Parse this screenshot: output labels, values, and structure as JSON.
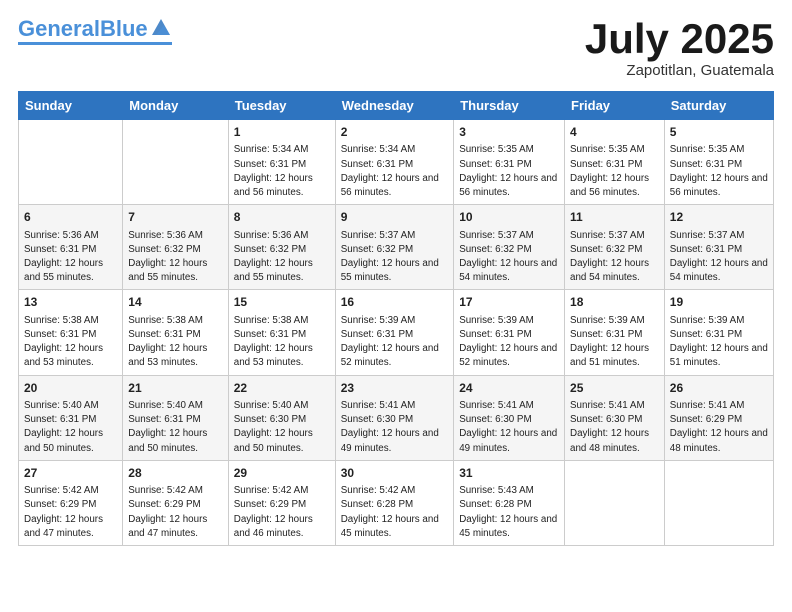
{
  "logo": {
    "part1": "General",
    "part2": "Blue"
  },
  "title": "July 2025",
  "location": "Zapotitlan, Guatemala",
  "days_of_week": [
    "Sunday",
    "Monday",
    "Tuesday",
    "Wednesday",
    "Thursday",
    "Friday",
    "Saturday"
  ],
  "weeks": [
    [
      {
        "day": "",
        "info": ""
      },
      {
        "day": "",
        "info": ""
      },
      {
        "day": "1",
        "info": "Sunrise: 5:34 AM\nSunset: 6:31 PM\nDaylight: 12 hours and 56 minutes."
      },
      {
        "day": "2",
        "info": "Sunrise: 5:34 AM\nSunset: 6:31 PM\nDaylight: 12 hours and 56 minutes."
      },
      {
        "day": "3",
        "info": "Sunrise: 5:35 AM\nSunset: 6:31 PM\nDaylight: 12 hours and 56 minutes."
      },
      {
        "day": "4",
        "info": "Sunrise: 5:35 AM\nSunset: 6:31 PM\nDaylight: 12 hours and 56 minutes."
      },
      {
        "day": "5",
        "info": "Sunrise: 5:35 AM\nSunset: 6:31 PM\nDaylight: 12 hours and 56 minutes."
      }
    ],
    [
      {
        "day": "6",
        "info": "Sunrise: 5:36 AM\nSunset: 6:31 PM\nDaylight: 12 hours and 55 minutes."
      },
      {
        "day": "7",
        "info": "Sunrise: 5:36 AM\nSunset: 6:32 PM\nDaylight: 12 hours and 55 minutes."
      },
      {
        "day": "8",
        "info": "Sunrise: 5:36 AM\nSunset: 6:32 PM\nDaylight: 12 hours and 55 minutes."
      },
      {
        "day": "9",
        "info": "Sunrise: 5:37 AM\nSunset: 6:32 PM\nDaylight: 12 hours and 55 minutes."
      },
      {
        "day": "10",
        "info": "Sunrise: 5:37 AM\nSunset: 6:32 PM\nDaylight: 12 hours and 54 minutes."
      },
      {
        "day": "11",
        "info": "Sunrise: 5:37 AM\nSunset: 6:32 PM\nDaylight: 12 hours and 54 minutes."
      },
      {
        "day": "12",
        "info": "Sunrise: 5:37 AM\nSunset: 6:31 PM\nDaylight: 12 hours and 54 minutes."
      }
    ],
    [
      {
        "day": "13",
        "info": "Sunrise: 5:38 AM\nSunset: 6:31 PM\nDaylight: 12 hours and 53 minutes."
      },
      {
        "day": "14",
        "info": "Sunrise: 5:38 AM\nSunset: 6:31 PM\nDaylight: 12 hours and 53 minutes."
      },
      {
        "day": "15",
        "info": "Sunrise: 5:38 AM\nSunset: 6:31 PM\nDaylight: 12 hours and 53 minutes."
      },
      {
        "day": "16",
        "info": "Sunrise: 5:39 AM\nSunset: 6:31 PM\nDaylight: 12 hours and 52 minutes."
      },
      {
        "day": "17",
        "info": "Sunrise: 5:39 AM\nSunset: 6:31 PM\nDaylight: 12 hours and 52 minutes."
      },
      {
        "day": "18",
        "info": "Sunrise: 5:39 AM\nSunset: 6:31 PM\nDaylight: 12 hours and 51 minutes."
      },
      {
        "day": "19",
        "info": "Sunrise: 5:39 AM\nSunset: 6:31 PM\nDaylight: 12 hours and 51 minutes."
      }
    ],
    [
      {
        "day": "20",
        "info": "Sunrise: 5:40 AM\nSunset: 6:31 PM\nDaylight: 12 hours and 50 minutes."
      },
      {
        "day": "21",
        "info": "Sunrise: 5:40 AM\nSunset: 6:31 PM\nDaylight: 12 hours and 50 minutes."
      },
      {
        "day": "22",
        "info": "Sunrise: 5:40 AM\nSunset: 6:30 PM\nDaylight: 12 hours and 50 minutes."
      },
      {
        "day": "23",
        "info": "Sunrise: 5:41 AM\nSunset: 6:30 PM\nDaylight: 12 hours and 49 minutes."
      },
      {
        "day": "24",
        "info": "Sunrise: 5:41 AM\nSunset: 6:30 PM\nDaylight: 12 hours and 49 minutes."
      },
      {
        "day": "25",
        "info": "Sunrise: 5:41 AM\nSunset: 6:30 PM\nDaylight: 12 hours and 48 minutes."
      },
      {
        "day": "26",
        "info": "Sunrise: 5:41 AM\nSunset: 6:29 PM\nDaylight: 12 hours and 48 minutes."
      }
    ],
    [
      {
        "day": "27",
        "info": "Sunrise: 5:42 AM\nSunset: 6:29 PM\nDaylight: 12 hours and 47 minutes."
      },
      {
        "day": "28",
        "info": "Sunrise: 5:42 AM\nSunset: 6:29 PM\nDaylight: 12 hours and 47 minutes."
      },
      {
        "day": "29",
        "info": "Sunrise: 5:42 AM\nSunset: 6:29 PM\nDaylight: 12 hours and 46 minutes."
      },
      {
        "day": "30",
        "info": "Sunrise: 5:42 AM\nSunset: 6:28 PM\nDaylight: 12 hours and 45 minutes."
      },
      {
        "day": "31",
        "info": "Sunrise: 5:43 AM\nSunset: 6:28 PM\nDaylight: 12 hours and 45 minutes."
      },
      {
        "day": "",
        "info": ""
      },
      {
        "day": "",
        "info": ""
      }
    ]
  ]
}
